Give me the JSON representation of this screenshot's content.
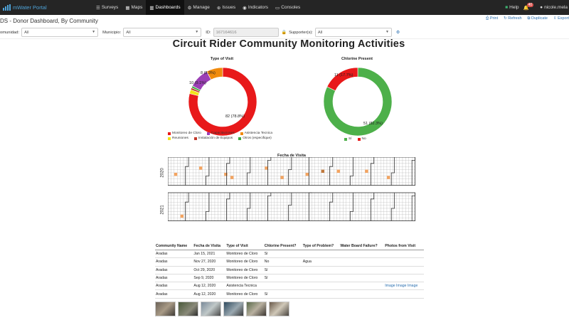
{
  "navbar": {
    "brand": "mWater Portal",
    "items": [
      {
        "label": "Surveys",
        "icon": "list-icon"
      },
      {
        "label": "Maps",
        "icon": "map-icon"
      },
      {
        "label": "Dashboards",
        "icon": "chart-icon",
        "active": true
      },
      {
        "label": "Manage",
        "icon": "gear-icon"
      },
      {
        "label": "Issues",
        "icon": "alert-icon"
      },
      {
        "label": "Indicators",
        "icon": "indicator-icon"
      },
      {
        "label": "Consoles",
        "icon": "monitor-icon"
      }
    ],
    "help": "Help",
    "notifications": "40",
    "user": "nicole.mela"
  },
  "titlebar": {
    "title": "DS - Donor Dashboard, By Community",
    "actions": [
      "Print",
      "Refresh",
      "Duplicate",
      "Export"
    ]
  },
  "filters": {
    "community_label": "omunidad:",
    "community_value": "All",
    "municipio_label": "Municipio:",
    "municipio_value": "All",
    "id_label": "ID:",
    "id_value": "167164616",
    "supporter_label": "Supporter(s):",
    "supporter_value": "All"
  },
  "main_title": "Circuit Rider Community Monitoring Activities",
  "chart_data": [
    {
      "type": "pie",
      "title": "Type of Visit",
      "categories": [
        "Monitoreo de Cloro",
        "Capacitaciones",
        "Asistencia Tecnica",
        "Reuniones",
        "Instalación de Equipos",
        "Otros (especifique)"
      ],
      "values": [
        82,
        10,
        8,
        2,
        1,
        1
      ],
      "slice_labels": [
        "82 (78.8%)",
        "10 (9.1%)",
        "8 (8.3%)",
        "",
        "",
        ""
      ],
      "colors": [
        "#e8191a",
        "#9b3fb5",
        "#f08a0c",
        "#f2e31b",
        "#c0392b",
        "#39a83c"
      ],
      "legend_position": "bottom"
    },
    {
      "type": "pie",
      "title": "Chlorine Present",
      "categories": [
        "Sí",
        "No"
      ],
      "values": [
        51,
        11
      ],
      "slice_labels": [
        "51 (82.3%)",
        "11 (17.7%)"
      ],
      "colors": [
        "#4db04a",
        "#e8191a"
      ],
      "legend_position": "bottom"
    },
    {
      "type": "heatmap",
      "title": "Fecha de Visita",
      "years": [
        "2020",
        "2021"
      ]
    }
  ],
  "table": {
    "headers": [
      "Community Name",
      "Fecha de Visita",
      "Type of Visit",
      "Chlorine Present?",
      "Type of Problem?",
      "Water Board Failure?",
      "Photos from Visit"
    ],
    "rows": [
      [
        "Aradas",
        "Jan 15, 2021",
        "Monitoreo de Cloro",
        "Sí",
        "",
        "",
        ""
      ],
      [
        "Aradas",
        "Nov 27, 2020",
        "Monitoreo de Cloro",
        "No",
        "Agua",
        "",
        ""
      ],
      [
        "Aradas",
        "Oct 29, 2020",
        "Monitoreo de Cloro",
        "Sí",
        "",
        "",
        ""
      ],
      [
        "Aradas",
        "Sep 9, 2020",
        "Monitoreo de Cloro",
        "Sí",
        "",
        "",
        ""
      ],
      [
        "Aradas",
        "Aug 12, 2020",
        "Asistencia Tecnica",
        "",
        "",
        "",
        "Image Image Image"
      ],
      [
        "Aradas",
        "Aug 12, 2020",
        "Monitoreo de Cloro",
        "Sí",
        "",
        "",
        ""
      ]
    ]
  },
  "photos_count": 6
}
